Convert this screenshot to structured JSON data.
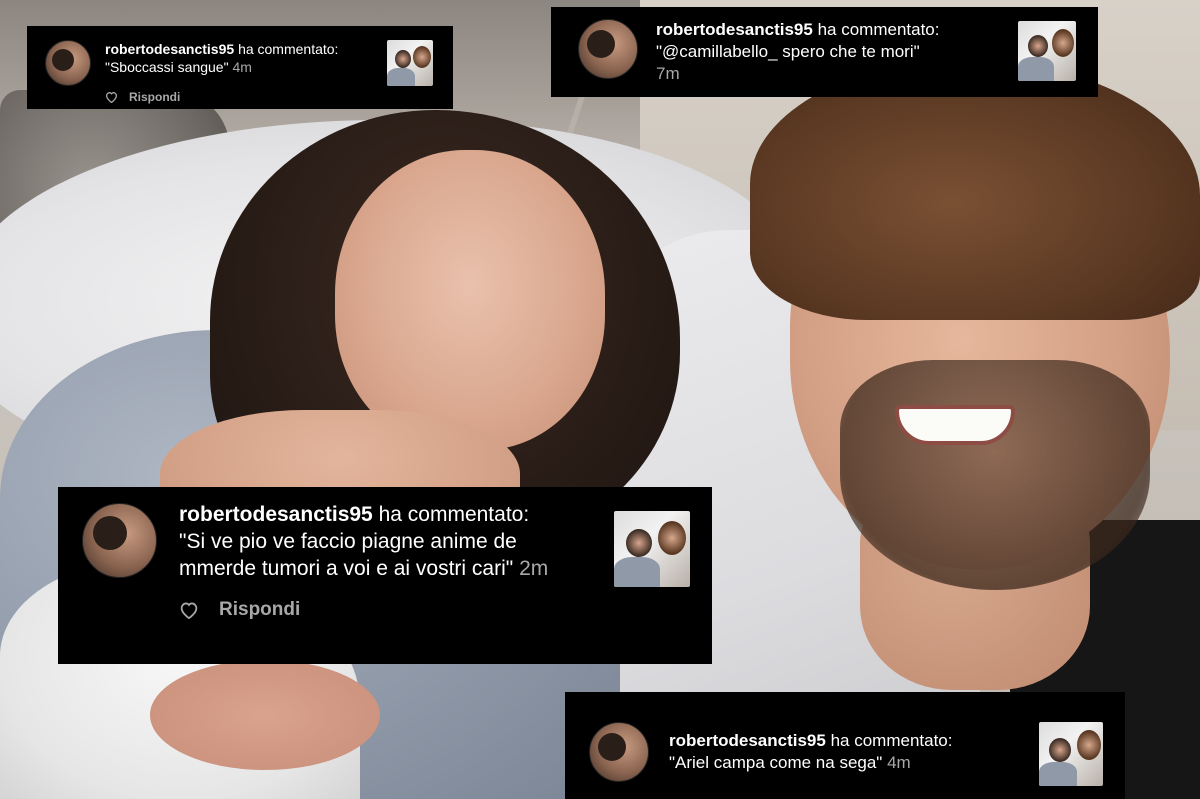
{
  "comments": [
    {
      "username": "robertodesanctis95",
      "action": "ha commentato:",
      "text": "\"Sboccassi sangue\"",
      "time": "4m",
      "reply": "Rispondi"
    },
    {
      "username": "robertodesanctis95",
      "action": "ha commentato:",
      "text": "\"@camillabello_ spero che te mori\"",
      "time": "7m"
    },
    {
      "username": "robertodesanctis95",
      "action": "ha commentato:",
      "text": "\"Si ve pio ve faccio piagne anime de mmerde tumori a voi e ai vostri cari\"",
      "time": "2m",
      "reply": "Rispondi"
    },
    {
      "username": "robertodesanctis95",
      "action": "ha commentato:",
      "text": "\"Ariel campa come na sega\"",
      "time": "4m"
    }
  ],
  "icons": {
    "like": "heart-outline-icon"
  },
  "colors": {
    "overlay_bg": "#000000",
    "text": "#ffffff",
    "secondary_text": "#a8a8a8"
  }
}
